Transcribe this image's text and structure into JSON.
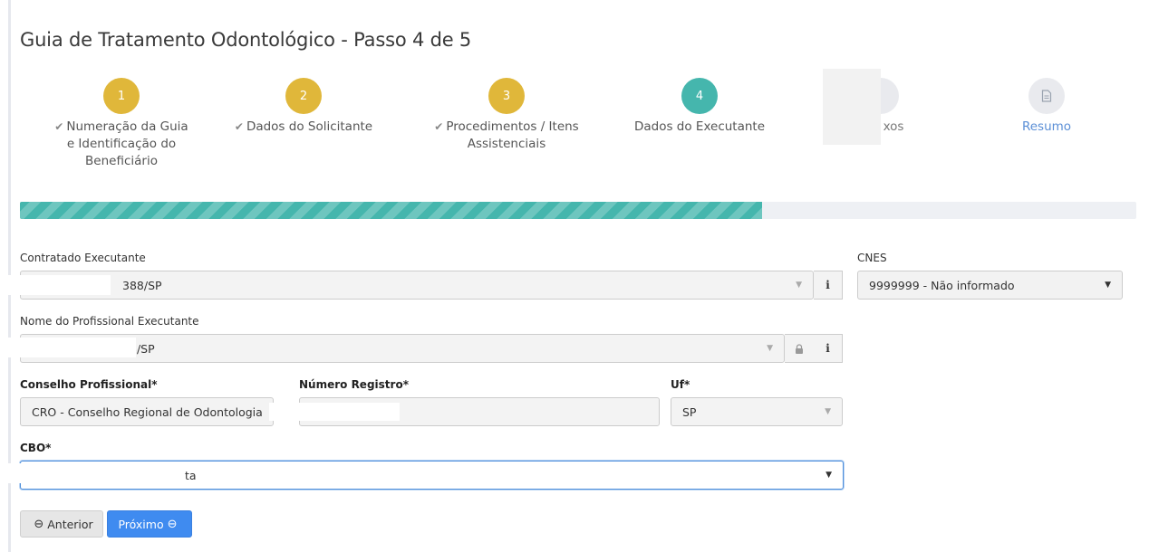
{
  "page": {
    "title": "Guia de Tratamento Odontológico - Passo 4 de 5"
  },
  "colors": {
    "done": "#e0b73a",
    "active": "#45b6ad",
    "todo": "#e9eaee",
    "primary": "#3f8bf0"
  },
  "steps": [
    {
      "number": "1",
      "label": "Numeração da Guia e Identificação do Beneficiário",
      "state": "done",
      "icon": "check-icon"
    },
    {
      "number": "2",
      "label": "Dados do Solicitante",
      "state": "done",
      "icon": "check-icon"
    },
    {
      "number": "3",
      "label": "Procedimentos / Itens Assistenciais",
      "state": "done",
      "icon": "check-icon"
    },
    {
      "number": "4",
      "label": "Dados do Executante",
      "state": "active"
    },
    {
      "number": "",
      "label": "xos",
      "state": "todo"
    },
    {
      "number": "",
      "label": "Resumo",
      "state": "todo",
      "icon": "document-icon"
    }
  ],
  "progress": {
    "fraction": 0.665
  },
  "form": {
    "contratado": {
      "label": "Contratado Executante",
      "value": "388/SP"
    },
    "cnes": {
      "label": "CNES",
      "value": "9999999 - Não informado"
    },
    "profissional": {
      "label": "Nome do Profissional Executante",
      "value": "8/SP"
    },
    "conselho": {
      "label": "Conselho Profissional*",
      "value": "CRO - Conselho Regional de Odontologia"
    },
    "registro": {
      "label": "Número Registro*",
      "value": ""
    },
    "uf": {
      "label": "Uf*",
      "value": "SP"
    },
    "cbo": {
      "label": "CBO*",
      "value": "ta"
    }
  },
  "buttons": {
    "prev": "Anterior",
    "next": "Próximo"
  }
}
